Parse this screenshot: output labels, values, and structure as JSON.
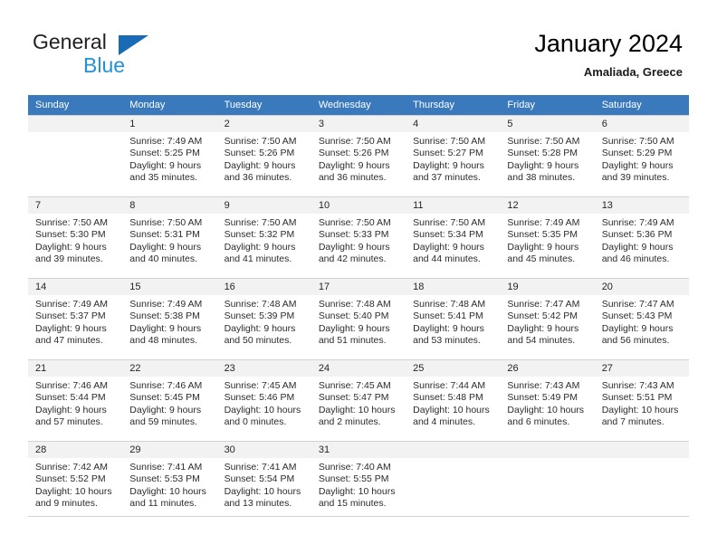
{
  "brand": {
    "line1": "General",
    "line2": "Blue",
    "triangle_color": "#1a6bb5",
    "blue_text_color": "#2390d8"
  },
  "header": {
    "title": "January 2024",
    "subtitle": "Amaliada, Greece"
  },
  "theme": {
    "header_row_bg": "#3b79bd",
    "daynum_bg": "#f2f2f2",
    "grid_line": "#d2d2d2"
  },
  "labels": {
    "sunrise_prefix": "Sunrise:",
    "sunset_prefix": "Sunset:",
    "daylight_prefix": "Daylight:"
  },
  "weekday_headers": [
    "Sunday",
    "Monday",
    "Tuesday",
    "Wednesday",
    "Thursday",
    "Friday",
    "Saturday"
  ],
  "weeks": [
    [
      {
        "day": "",
        "empty": true
      },
      {
        "day": "1",
        "sunrise": "Sunrise: 7:49 AM",
        "sunset": "Sunset: 5:25 PM",
        "daylight1": "Daylight: 9 hours",
        "daylight2": "and 35 minutes."
      },
      {
        "day": "2",
        "sunrise": "Sunrise: 7:50 AM",
        "sunset": "Sunset: 5:26 PM",
        "daylight1": "Daylight: 9 hours",
        "daylight2": "and 36 minutes."
      },
      {
        "day": "3",
        "sunrise": "Sunrise: 7:50 AM",
        "sunset": "Sunset: 5:26 PM",
        "daylight1": "Daylight: 9 hours",
        "daylight2": "and 36 minutes."
      },
      {
        "day": "4",
        "sunrise": "Sunrise: 7:50 AM",
        "sunset": "Sunset: 5:27 PM",
        "daylight1": "Daylight: 9 hours",
        "daylight2": "and 37 minutes."
      },
      {
        "day": "5",
        "sunrise": "Sunrise: 7:50 AM",
        "sunset": "Sunset: 5:28 PM",
        "daylight1": "Daylight: 9 hours",
        "daylight2": "and 38 minutes."
      },
      {
        "day": "6",
        "sunrise": "Sunrise: 7:50 AM",
        "sunset": "Sunset: 5:29 PM",
        "daylight1": "Daylight: 9 hours",
        "daylight2": "and 39 minutes."
      }
    ],
    [
      {
        "day": "7",
        "sunrise": "Sunrise: 7:50 AM",
        "sunset": "Sunset: 5:30 PM",
        "daylight1": "Daylight: 9 hours",
        "daylight2": "and 39 minutes."
      },
      {
        "day": "8",
        "sunrise": "Sunrise: 7:50 AM",
        "sunset": "Sunset: 5:31 PM",
        "daylight1": "Daylight: 9 hours",
        "daylight2": "and 40 minutes."
      },
      {
        "day": "9",
        "sunrise": "Sunrise: 7:50 AM",
        "sunset": "Sunset: 5:32 PM",
        "daylight1": "Daylight: 9 hours",
        "daylight2": "and 41 minutes."
      },
      {
        "day": "10",
        "sunrise": "Sunrise: 7:50 AM",
        "sunset": "Sunset: 5:33 PM",
        "daylight1": "Daylight: 9 hours",
        "daylight2": "and 42 minutes."
      },
      {
        "day": "11",
        "sunrise": "Sunrise: 7:50 AM",
        "sunset": "Sunset: 5:34 PM",
        "daylight1": "Daylight: 9 hours",
        "daylight2": "and 44 minutes."
      },
      {
        "day": "12",
        "sunrise": "Sunrise: 7:49 AM",
        "sunset": "Sunset: 5:35 PM",
        "daylight1": "Daylight: 9 hours",
        "daylight2": "and 45 minutes."
      },
      {
        "day": "13",
        "sunrise": "Sunrise: 7:49 AM",
        "sunset": "Sunset: 5:36 PM",
        "daylight1": "Daylight: 9 hours",
        "daylight2": "and 46 minutes."
      }
    ],
    [
      {
        "day": "14",
        "sunrise": "Sunrise: 7:49 AM",
        "sunset": "Sunset: 5:37 PM",
        "daylight1": "Daylight: 9 hours",
        "daylight2": "and 47 minutes."
      },
      {
        "day": "15",
        "sunrise": "Sunrise: 7:49 AM",
        "sunset": "Sunset: 5:38 PM",
        "daylight1": "Daylight: 9 hours",
        "daylight2": "and 48 minutes."
      },
      {
        "day": "16",
        "sunrise": "Sunrise: 7:48 AM",
        "sunset": "Sunset: 5:39 PM",
        "daylight1": "Daylight: 9 hours",
        "daylight2": "and 50 minutes."
      },
      {
        "day": "17",
        "sunrise": "Sunrise: 7:48 AM",
        "sunset": "Sunset: 5:40 PM",
        "daylight1": "Daylight: 9 hours",
        "daylight2": "and 51 minutes."
      },
      {
        "day": "18",
        "sunrise": "Sunrise: 7:48 AM",
        "sunset": "Sunset: 5:41 PM",
        "daylight1": "Daylight: 9 hours",
        "daylight2": "and 53 minutes."
      },
      {
        "day": "19",
        "sunrise": "Sunrise: 7:47 AM",
        "sunset": "Sunset: 5:42 PM",
        "daylight1": "Daylight: 9 hours",
        "daylight2": "and 54 minutes."
      },
      {
        "day": "20",
        "sunrise": "Sunrise: 7:47 AM",
        "sunset": "Sunset: 5:43 PM",
        "daylight1": "Daylight: 9 hours",
        "daylight2": "and 56 minutes."
      }
    ],
    [
      {
        "day": "21",
        "sunrise": "Sunrise: 7:46 AM",
        "sunset": "Sunset: 5:44 PM",
        "daylight1": "Daylight: 9 hours",
        "daylight2": "and 57 minutes."
      },
      {
        "day": "22",
        "sunrise": "Sunrise: 7:46 AM",
        "sunset": "Sunset: 5:45 PM",
        "daylight1": "Daylight: 9 hours",
        "daylight2": "and 59 minutes."
      },
      {
        "day": "23",
        "sunrise": "Sunrise: 7:45 AM",
        "sunset": "Sunset: 5:46 PM",
        "daylight1": "Daylight: 10 hours",
        "daylight2": "and 0 minutes."
      },
      {
        "day": "24",
        "sunrise": "Sunrise: 7:45 AM",
        "sunset": "Sunset: 5:47 PM",
        "daylight1": "Daylight: 10 hours",
        "daylight2": "and 2 minutes."
      },
      {
        "day": "25",
        "sunrise": "Sunrise: 7:44 AM",
        "sunset": "Sunset: 5:48 PM",
        "daylight1": "Daylight: 10 hours",
        "daylight2": "and 4 minutes."
      },
      {
        "day": "26",
        "sunrise": "Sunrise: 7:43 AM",
        "sunset": "Sunset: 5:49 PM",
        "daylight1": "Daylight: 10 hours",
        "daylight2": "and 6 minutes."
      },
      {
        "day": "27",
        "sunrise": "Sunrise: 7:43 AM",
        "sunset": "Sunset: 5:51 PM",
        "daylight1": "Daylight: 10 hours",
        "daylight2": "and 7 minutes."
      }
    ],
    [
      {
        "day": "28",
        "sunrise": "Sunrise: 7:42 AM",
        "sunset": "Sunset: 5:52 PM",
        "daylight1": "Daylight: 10 hours",
        "daylight2": "and 9 minutes."
      },
      {
        "day": "29",
        "sunrise": "Sunrise: 7:41 AM",
        "sunset": "Sunset: 5:53 PM",
        "daylight1": "Daylight: 10 hours",
        "daylight2": "and 11 minutes."
      },
      {
        "day": "30",
        "sunrise": "Sunrise: 7:41 AM",
        "sunset": "Sunset: 5:54 PM",
        "daylight1": "Daylight: 10 hours",
        "daylight2": "and 13 minutes."
      },
      {
        "day": "31",
        "sunrise": "Sunrise: 7:40 AM",
        "sunset": "Sunset: 5:55 PM",
        "daylight1": "Daylight: 10 hours",
        "daylight2": "and 15 minutes."
      },
      {
        "day": "",
        "empty": true
      },
      {
        "day": "",
        "empty": true
      },
      {
        "day": "",
        "empty": true
      }
    ]
  ]
}
